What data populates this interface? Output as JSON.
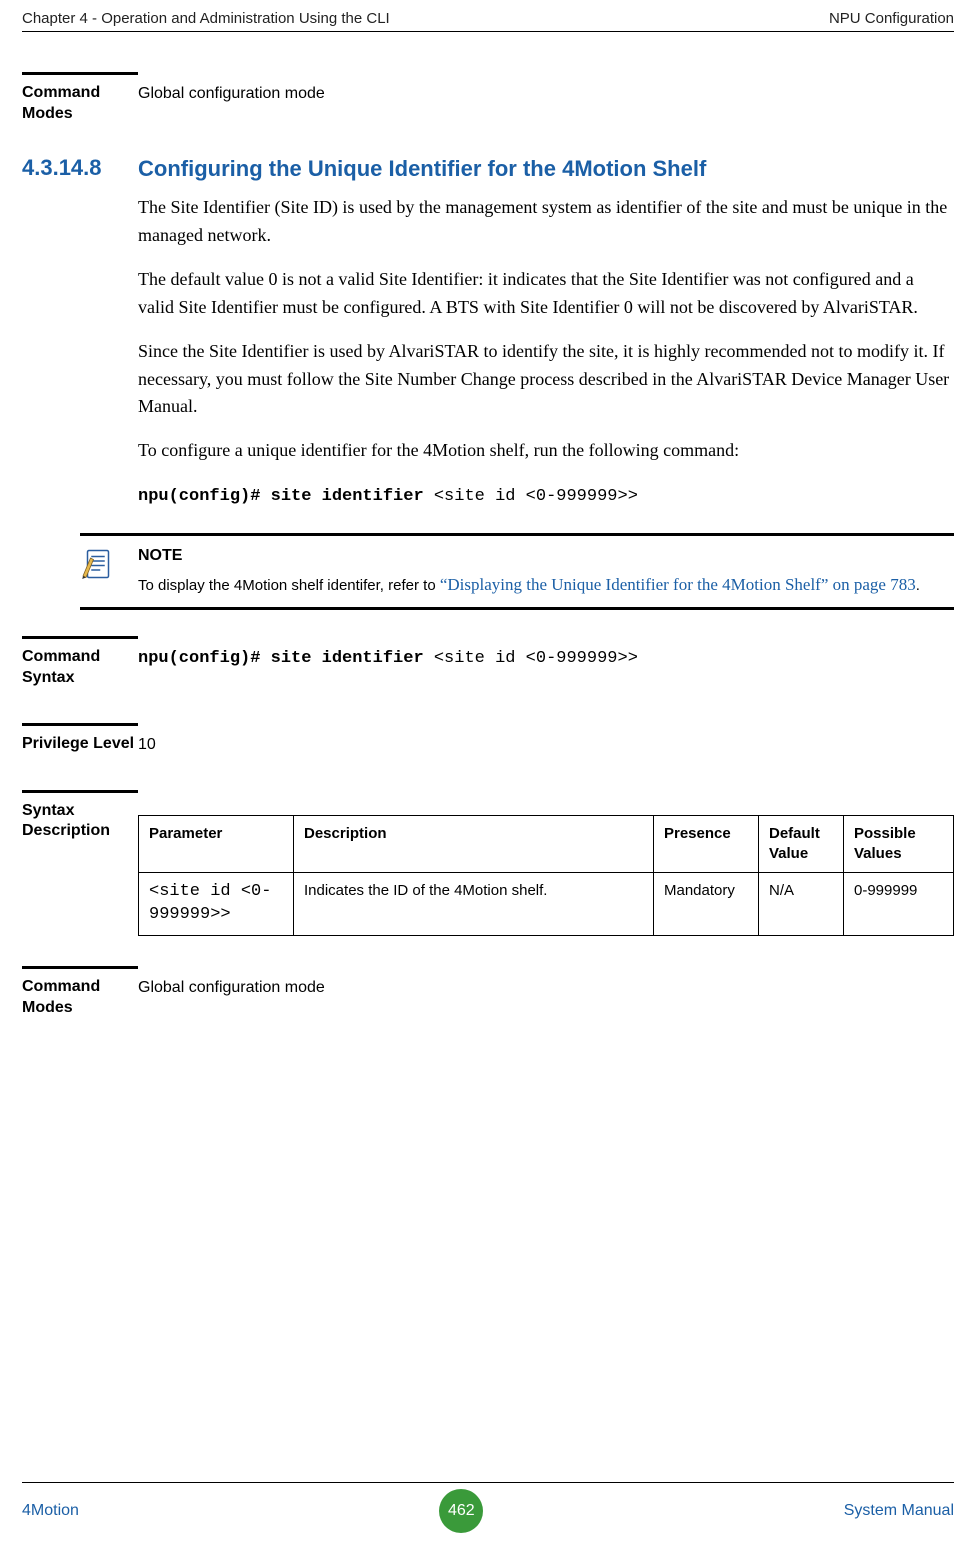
{
  "header": {
    "left": "Chapter 4 - Operation and Administration Using the CLI",
    "right": "NPU Configuration"
  },
  "top_block": {
    "label": "Command Modes",
    "value": "Global configuration mode"
  },
  "section": {
    "number": "4.3.14.8",
    "title": "Configuring the Unique Identifier for the 4Motion Shelf",
    "para1": "The Site Identifier (Site ID) is used by the management system as identifier of the site and must be unique in the managed network.",
    "para2": "The default value 0 is not a valid Site Identifier: it indicates that the Site Identifier was not configured and a valid Site Identifier must be configured. A BTS with Site Identifier 0 will not be discovered by AlvariSTAR.",
    "para3": "Since the Site Identifier is used by AlvariSTAR to identify the site, it is highly recommended not to modify it. If necessary, you must follow the Site Number Change process described in the AlvariSTAR Device Manager User Manual.",
    "para4": "To configure a unique identifier for the 4Motion shelf, run the following command:",
    "cmd_bold": "npu(config)# site identifier ",
    "cmd_rest": "<site id <0-999999>>"
  },
  "note": {
    "heading": "NOTE",
    "lead": "To display the 4Motion shelf identifer, refer to ",
    "xref": "“Displaying the Unique Identifier for the 4Motion Shelf” on page 783",
    "tail": "."
  },
  "cmd_syntax": {
    "label": "Command Syntax",
    "bold": "npu(config)# site identifier ",
    "rest": "<site id <0-999999>>"
  },
  "priv": {
    "label": "Privilege Level",
    "value": "10"
  },
  "syntax_desc": {
    "label": "Syntax Description",
    "headers": {
      "param": "Parameter",
      "desc": "Description",
      "presence": "Presence",
      "default": "Default Value",
      "possible": "Possible Values"
    },
    "row": {
      "param": "<site id <0-999999>>",
      "desc": "Indicates the ID of the 4Motion shelf.",
      "presence": "Mandatory",
      "default": "N/A",
      "possible": "0-999999"
    }
  },
  "bottom_block": {
    "label": "Command Modes",
    "value": "Global configuration mode"
  },
  "footer": {
    "left": "4Motion",
    "page": "462",
    "right": "System Manual"
  }
}
